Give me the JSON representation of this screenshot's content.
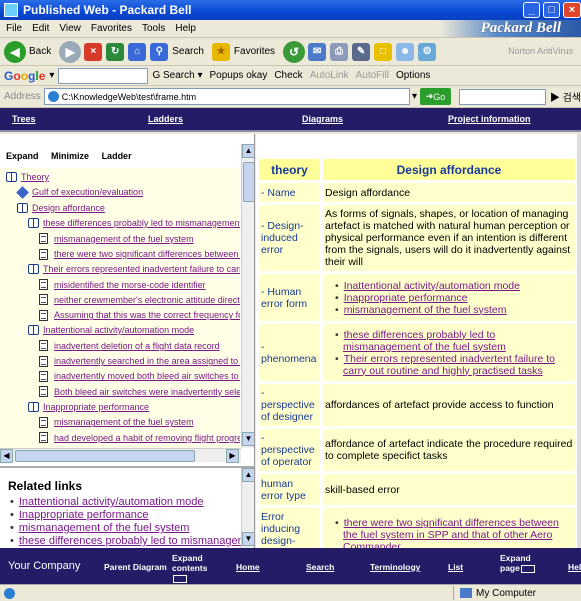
{
  "window": {
    "title": "Published Web - Packard Bell",
    "brand": "Packard Bell"
  },
  "menu": [
    "File",
    "Edit",
    "View",
    "Favorites",
    "Tools",
    "Help"
  ],
  "toolbar": {
    "back": "Back",
    "search": "Search",
    "favorites": "Favorites",
    "norton": "Norton AntiVirus"
  },
  "googlebar": {
    "logo": "Google",
    "search": "Search",
    "popups": "Popups okay",
    "check": "Check",
    "autolink": "AutoLink",
    "autofill": "AutoFill",
    "options": "Options"
  },
  "address": {
    "label": "Address",
    "value": "C:\\KnowledgeWeb\\test\\frame.htm",
    "go": "Go",
    "search_btn": "검색"
  },
  "frame_nav": [
    "Trees",
    "Ladders",
    "Diagrams",
    "Project information"
  ],
  "left_tabs": [
    "Expand",
    "Minimize",
    "Ladder"
  ],
  "tree": [
    {
      "icon": "book",
      "label": "Theory"
    },
    {
      "icon": "diamond",
      "label": "Gulf of execution/evaluation"
    },
    {
      "icon": "book",
      "label": "Design affordance"
    },
    {
      "icon": "book",
      "label": "these differences probably led to mismanagement of the"
    },
    {
      "icon": "page",
      "label": "mismanagement of the fuel system"
    },
    {
      "icon": "page",
      "label": "there were two significant differences between the fu"
    },
    {
      "icon": "book",
      "label": "Their errors represented inadvertent failure to carry out"
    },
    {
      "icon": "page",
      "label": "misidentified the morse-code identifier"
    },
    {
      "icon": "page",
      "label": "neither crewmember's electronic attitude direction in"
    },
    {
      "icon": "page",
      "label": "Assuming that this was the correct frequency for the"
    },
    {
      "icon": "book",
      "label": "Inattentional activity/automation mode"
    },
    {
      "icon": "page",
      "label": "inadvertent deletion of a flight data record"
    },
    {
      "icon": "page",
      "label": "inadvertently searched in the area assigned to the Co"
    },
    {
      "icon": "page",
      "label": "inadvertently moved both bleed air switches to ENVIF"
    },
    {
      "icon": "page",
      "label": "Both bleed air switches were inadvertently selected t"
    },
    {
      "icon": "book",
      "label": "Inappropriate performance"
    },
    {
      "icon": "page",
      "label": "mismanagement of the fuel system"
    },
    {
      "icon": "page",
      "label": "had developed a habit of removing flight progress str"
    }
  ],
  "related": {
    "heading": "Related links",
    "links": [
      "Inattentional activity/automation mode",
      "Inappropriate performance",
      "mismanagement of the fuel system",
      "these differences probably led to mismanagement"
    ]
  },
  "detail": {
    "header": {
      "key": "theory",
      "value": "Design affordance"
    },
    "rows": [
      {
        "key": "- Name",
        "value": "Design affordance"
      },
      {
        "key": "- Design-induced error",
        "value": "As forms of signals, shapes, or location of managing artefact is matched with natural human perception or physical performance even if an intention is different from the signals, users will do it inadvertently against their will"
      },
      {
        "key": "- Human error form",
        "links": [
          "Inattentional activity/automation mode",
          "Inappropriate performance",
          "mismanagement of the fuel system"
        ]
      },
      {
        "key": "- phenomena",
        "links": [
          "these differences probably led to mismanagement of the fuel system",
          "Their errors represented inadvertent failure to carry out routine and highly practised tasks"
        ]
      },
      {
        "key": "- perspective of designer",
        "value": "affordances of artefact provide access to function"
      },
      {
        "key": "- perspective of operator",
        "value": "affordance of artefact indicate the procedure required to complete specifict tasks"
      },
      {
        "key": "human error type",
        "value": "skill-based error"
      },
      {
        "key": "Error inducing design-interface",
        "links": [
          "there were two significant differences between the fuel system in SPP and that of other Aero Commander"
        ]
      }
    ]
  },
  "footer": {
    "company": "Your Company",
    "parent": "Parent Diagram",
    "expand_contents": "Expand contents",
    "home": "Home",
    "search": "Search",
    "terminology": "Terminology",
    "list": "List",
    "expand_page": "Expand page",
    "help": "Help"
  },
  "status": {
    "zone": "My Computer"
  }
}
